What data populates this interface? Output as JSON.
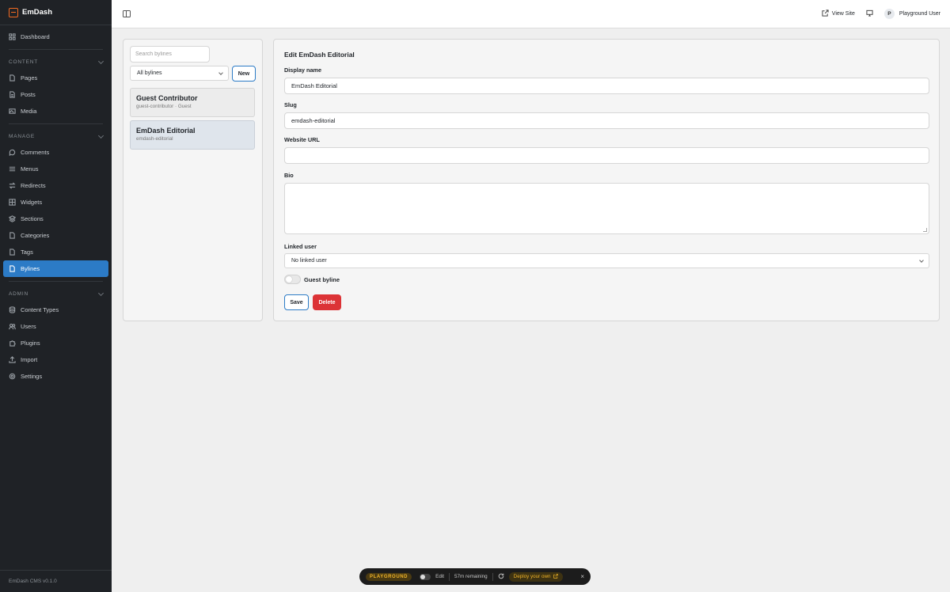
{
  "brand": {
    "name": "EmDash",
    "version": "EmDash CMS v0.1.0"
  },
  "sidebar": {
    "dashboard": "Dashboard",
    "sections": [
      {
        "title": "CONTENT",
        "items": [
          "Pages",
          "Posts",
          "Media"
        ]
      },
      {
        "title": "MANAGE",
        "items": [
          "Comments",
          "Menus",
          "Redirects",
          "Widgets",
          "Sections",
          "Categories",
          "Tags",
          "Bylines"
        ]
      },
      {
        "title": "ADMIN",
        "items": [
          "Content Types",
          "Users",
          "Plugins",
          "Import",
          "Settings"
        ]
      }
    ],
    "active": "Bylines"
  },
  "topbar": {
    "view_site": "View Site",
    "user_initial": "P",
    "user_name": "Playground User"
  },
  "list": {
    "search_placeholder": "Search bylines",
    "filter": "All bylines",
    "new_label": "New",
    "items": [
      {
        "title": "Guest Contributor",
        "sub": "guest-contributor · Guest"
      },
      {
        "title": "EmDash Editorial",
        "sub": "emdash-editorial"
      }
    ]
  },
  "editor": {
    "title": "Edit EmDash Editorial",
    "display_name_label": "Display name",
    "display_name_value": "EmDash Editorial",
    "slug_label": "Slug",
    "slug_value": "emdash-editorial",
    "website_label": "Website URL",
    "website_value": "",
    "bio_label": "Bio",
    "bio_value": "",
    "linked_user_label": "Linked user",
    "linked_user_value": "No linked user",
    "guest_label": "Guest byline",
    "save_label": "Save",
    "delete_label": "Delete"
  },
  "playground": {
    "badge": "PLAYGROUND",
    "edit_label": "Edit",
    "remaining": "57m remaining",
    "deploy_label": "Deploy your own",
    "close": "×"
  },
  "colors": {
    "accent": "#2c7bc6",
    "danger": "#dc3336",
    "brand": "#f26a21",
    "sidebar_bg": "#1f2226"
  }
}
